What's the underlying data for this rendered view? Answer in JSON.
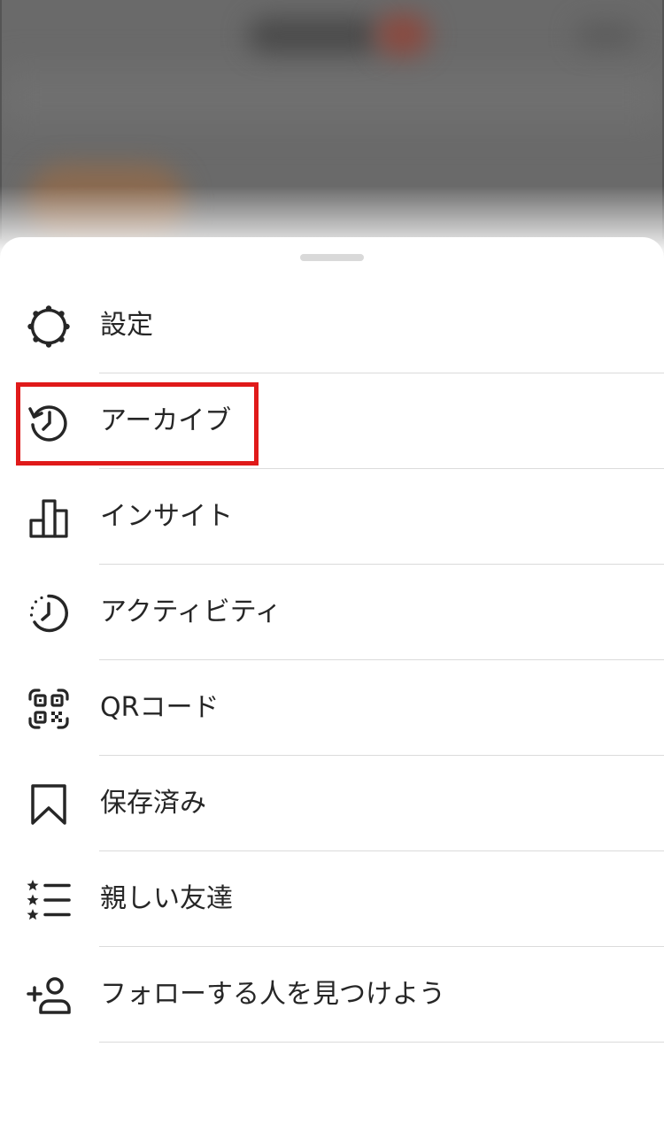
{
  "menu": {
    "items": [
      {
        "label": "設定",
        "icon": "settings-icon"
      },
      {
        "label": "アーカイブ",
        "icon": "archive-icon"
      },
      {
        "label": "インサイト",
        "icon": "insights-icon"
      },
      {
        "label": "アクティビティ",
        "icon": "activity-icon"
      },
      {
        "label": "QRコード",
        "icon": "qr-code-icon"
      },
      {
        "label": "保存済み",
        "icon": "saved-icon"
      },
      {
        "label": "親しい友達",
        "icon": "close-friends-icon"
      },
      {
        "label": "フォローする人を見つけよう",
        "icon": "discover-people-icon"
      }
    ]
  },
  "colors": {
    "text": "#262626",
    "divider": "#dbdbdb",
    "highlight": "#e01a1a",
    "handle": "#d9d9d9"
  }
}
